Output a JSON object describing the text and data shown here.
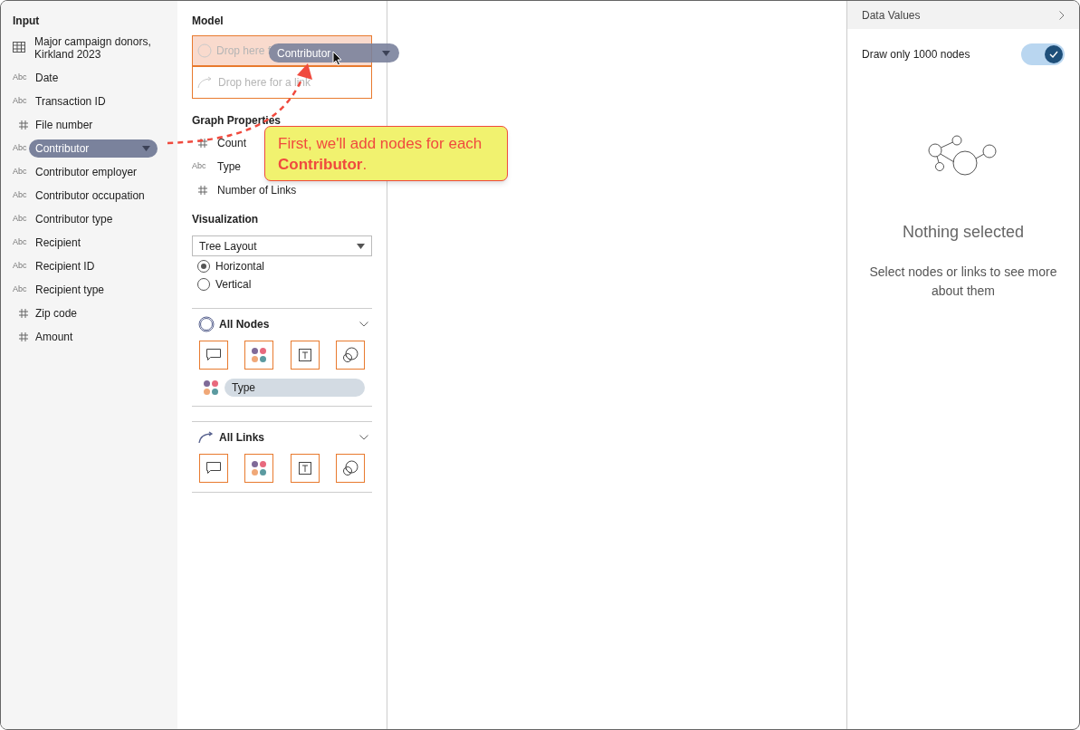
{
  "input": {
    "title": "Input",
    "dataset": "Major campaign donors, Kirkland 2023",
    "fields": [
      {
        "kind": "text",
        "type_label": "Abc",
        "name": "Date",
        "selected": false
      },
      {
        "kind": "text",
        "type_label": "Abc",
        "name": "Transaction ID",
        "selected": false
      },
      {
        "kind": "number",
        "name": "File number",
        "selected": false
      },
      {
        "kind": "text",
        "type_label": "Abc",
        "name": "Contributor",
        "selected": true
      },
      {
        "kind": "text",
        "type_label": "Abc",
        "name": "Contributor employer",
        "selected": false
      },
      {
        "kind": "text",
        "type_label": "Abc",
        "name": "Contributor occupation",
        "selected": false
      },
      {
        "kind": "text",
        "type_label": "Abc",
        "name": "Contributor type",
        "selected": false
      },
      {
        "kind": "text",
        "type_label": "Abc",
        "name": "Recipient",
        "selected": false
      },
      {
        "kind": "text",
        "type_label": "Abc",
        "name": "Recipient ID",
        "selected": false
      },
      {
        "kind": "text",
        "type_label": "Abc",
        "name": "Recipient type",
        "selected": false
      },
      {
        "kind": "number",
        "name": "Zip code",
        "selected": false
      },
      {
        "kind": "number",
        "name": "Amount",
        "selected": false
      }
    ]
  },
  "model": {
    "title": "Model",
    "node_drop": {
      "placeholder": "Drop here f",
      "highlighted": true
    },
    "link_drop": {
      "placeholder": "Drop here for a link",
      "highlighted": false
    }
  },
  "graph_properties": {
    "title": "Graph Properties",
    "items": [
      {
        "kind": "number",
        "name": "Count"
      },
      {
        "kind": "text",
        "type_label": "Abc",
        "name": "Type"
      },
      {
        "kind": "number",
        "name": "Number of Links"
      }
    ]
  },
  "visualization": {
    "title": "Visualization",
    "layout": "Tree Layout",
    "orientations": [
      {
        "label": "Horizontal",
        "selected": true
      },
      {
        "label": "Vertical",
        "selected": false
      }
    ]
  },
  "sections": [
    {
      "kind": "nodes",
      "title": "All Nodes",
      "color_field": "Type"
    },
    {
      "kind": "links",
      "title": "All Links"
    }
  ],
  "drag": {
    "label": "Contributor"
  },
  "callout": {
    "text": "First, we'll add nodes for each **Contributor**."
  },
  "details": {
    "title": "Data Values",
    "toggle": {
      "label": "Draw only 1000 nodes",
      "on": true
    },
    "empty_title": "Nothing selected",
    "empty_text": "Select nodes or links to see more about them"
  }
}
